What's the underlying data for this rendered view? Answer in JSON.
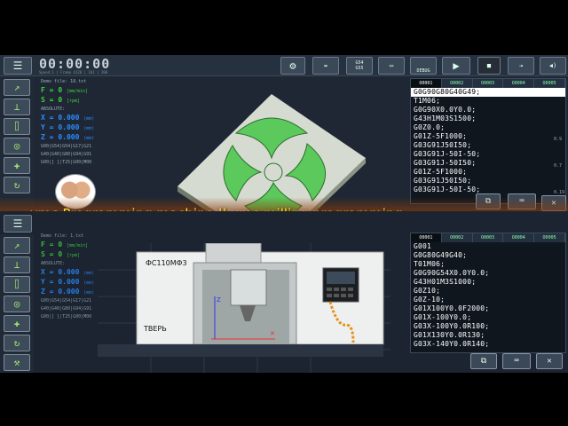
{
  "top_panel": {
    "clock": "00:00:00",
    "clock_info": "Speed:1 | Frame 4120 | 101 | 200",
    "file_label": "Demo file: 18.txt",
    "feed": {
      "label": "F",
      "value": "0",
      "unit": "[mm/min]"
    },
    "spindle": {
      "label": "S",
      "value": "0",
      "unit": "[rpm]"
    },
    "mode_label": "ABSOLUTE:",
    "x": {
      "label": "X",
      "value": "0.000",
      "unit": "(mm)"
    },
    "y": {
      "label": "Y",
      "value": "0.000",
      "unit": "(mm)"
    },
    "z": {
      "label": "Z",
      "value": "0.000",
      "unit": "(mm)"
    },
    "gcodes_line1": "G00|G54|G54|G17|G21",
    "gcodes_line2": "G40|G40|G80|G94|G91",
    "gcodes_line3": "G00|[ ]|T25|G00|M00",
    "toolbar_g54": "G54\nG55",
    "toolbar_debug": "DEBUG",
    "code_tabs": [
      "O0001",
      "O0002",
      "O0003",
      "O0004",
      "O0005"
    ],
    "code_lines": [
      "G0G90G80G40G49;",
      "T1M06;",
      "G0G90X0.0Y0.0;",
      "G43H1M03S1500;",
      "G0Z0.0;",
      "G01Z-5F1000;",
      "G03G91J50I50;",
      "G03G91J-50I-50;",
      "G03G91J-50I50;",
      "G01Z-5F1000;",
      "G03G91J50I50;",
      "G03G91J-50I-50;"
    ],
    "side_numbers": [
      "0.9",
      "0.7",
      "0.19"
    ]
  },
  "title": {
    "text": "vmc Programming machine  || vmc milling programming"
  },
  "bottom_panel": {
    "file_label": "Demo file: 1.txt",
    "feed": {
      "label": "F",
      "value": "0",
      "unit": "[mm/min]"
    },
    "spindle": {
      "label": "S",
      "value": "0",
      "unit": "[rpm]"
    },
    "mode_label": "ABSOLUTE:",
    "x": {
      "label": "X",
      "value": "0.000",
      "unit": "(mm)"
    },
    "y": {
      "label": "Y",
      "value": "0.000",
      "unit": "(mm)"
    },
    "z": {
      "label": "Z",
      "value": "0.000",
      "unit": "(mm)"
    },
    "gcodes_line1": "G00|G54|G54|G17|G21",
    "gcodes_line2": "G40|G40|G80|G94|G91",
    "gcodes_line3": "G00|[ ]|T25|G00|M00",
    "machine_model": "ФС110МФ3",
    "machine_brand": "ТВЕРЬ",
    "code_tabs": [
      "O0001",
      "O0002",
      "O0003",
      "O0004",
      "O0005"
    ],
    "code_lines": [
      "G001",
      "G0G80G49G40;",
      "T01M06;",
      "G0G90G54X0.0Y0.0;",
      "G43H01M3S1000;",
      "G0Z10;",
      "G0Z-10;",
      "G01X100Y0.0F2000;",
      "G01X-100Y0.0;",
      "G03X-100Y0.0R100;",
      "G01X130Y0.0R130;",
      "G03X-140Y0.0R140;"
    ]
  },
  "colors": {
    "panel": "#1e2733",
    "accent_green": "#3fd13f",
    "accent_blue": "#2a8cff",
    "title_yellow": "#f6e33a"
  }
}
